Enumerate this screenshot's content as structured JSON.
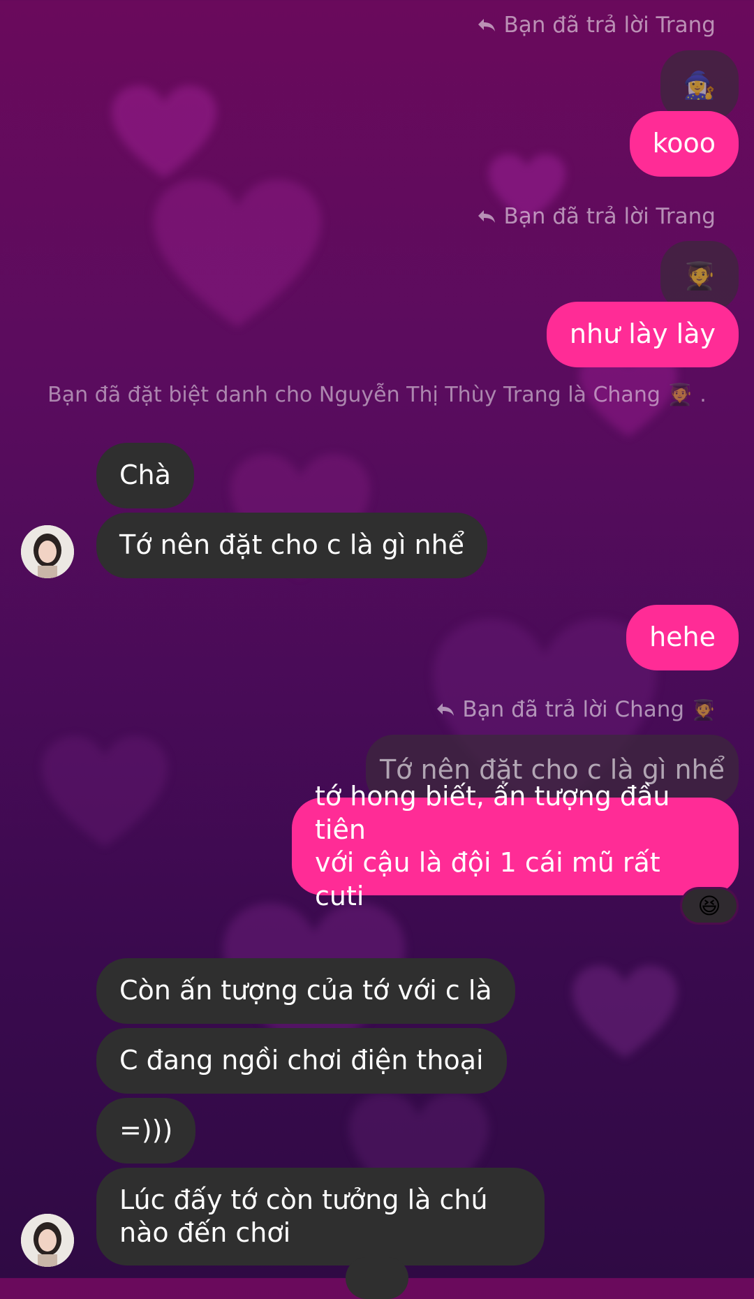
{
  "messages": {
    "reply1_meta": "Bạn đã trả lời Trang",
    "reply1_quote_emoji": "🧙‍♀️",
    "out1": "kooo",
    "reply2_meta": "Bạn đã trả lời Trang",
    "reply2_quote_emoji": "🧑‍🎓",
    "out2": "như lày lày",
    "system_note": "Bạn đã đặt biệt danh cho Nguyễn Thị Thùy Trang là Chang 🧑‍🎓 .",
    "in1": "Chà",
    "in2": "Tớ nên đặt cho c là gì nhể",
    "out3": "hehe",
    "reply3_meta": "Bạn đã trả lời Chang",
    "reply3_meta_emoji": "🧑‍🎓",
    "reply3_quote": "Tớ nên đặt cho c là gì nhể",
    "out4_line1": "tớ hong biết, ấn tượng đầu tiên",
    "out4_line2": "với cậu là đội 1 cái mũ rất cuti",
    "out4_reaction": "😆",
    "in3": "Còn ấn tượng của tớ với c là",
    "in4": "C đang ngồi chơi điện thoại",
    "in5": "=)))",
    "in6_line1": "Lúc đấy tớ còn tưởng là chú",
    "in6_line2": "nào đến chơi"
  },
  "colors": {
    "outgoing_bubble": "#ff2c96",
    "incoming_bubble": "#2f2f2f",
    "background_top": "#6a0a5c",
    "background_bottom": "#2f0a44"
  },
  "icons": {
    "reply_arrow": "reply-arrow-icon",
    "avatar": "contact-avatar"
  }
}
